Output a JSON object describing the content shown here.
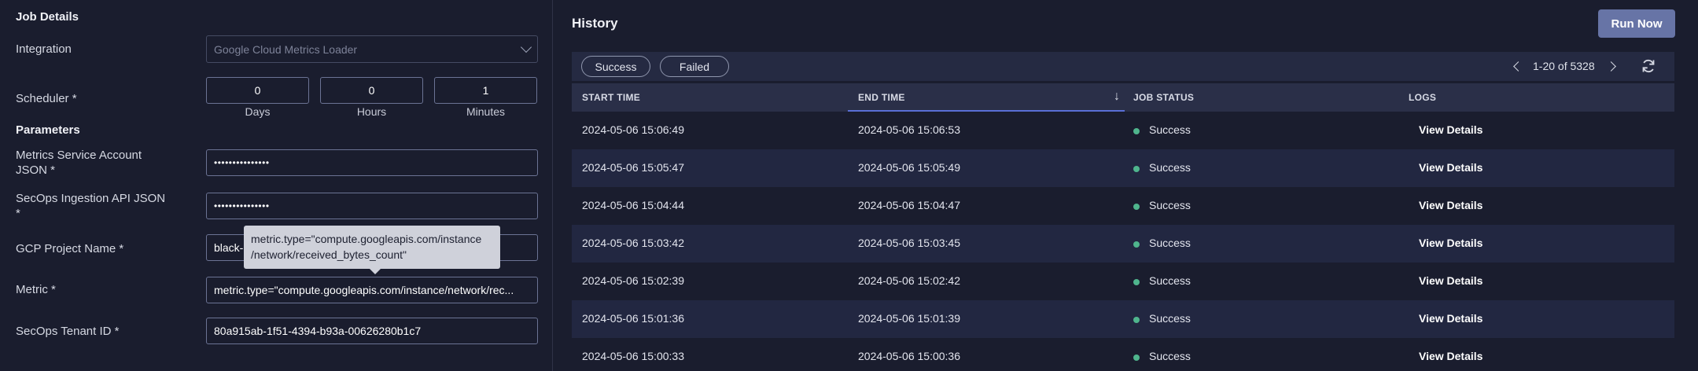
{
  "job_details": {
    "title": "Job Details",
    "integration_label": "Integration",
    "integration_value": "Google Cloud Metrics Loader",
    "scheduler_label": "Scheduler *",
    "scheduler": {
      "days_value": "0",
      "days_label": "Days",
      "hours_value": "0",
      "hours_label": "Hours",
      "minutes_value": "1",
      "minutes_label": "Minutes"
    }
  },
  "parameters": {
    "title": "Parameters",
    "metrics_sa_label_1": "Metrics Service Account",
    "metrics_sa_label_2": "JSON *",
    "metrics_sa_value": "•••••••••••••••",
    "ingestion_label_1": "SecOps Ingestion API JSON",
    "ingestion_label_2": "*",
    "ingestion_value": "•••••••••••••••",
    "gcp_project_label": "GCP Project Name *",
    "gcp_project_value": "black-",
    "metric_label": "Metric *",
    "metric_value": "metric.type=\"compute.googleapis.com/instance/network/rec...",
    "tenant_label": "SecOps Tenant ID *",
    "tenant_value": "80a915ab-1f51-4394-b93a-00626280b1c7"
  },
  "tooltip": {
    "line1": "metric.type=\"compute.googleapis.com/instance",
    "line2": "/network/received_bytes_count\""
  },
  "history": {
    "title": "History",
    "run_now": "Run Now",
    "filters": [
      "Success",
      "Failed"
    ],
    "pager_text": "1-20 of 5328",
    "columns": [
      "START TIME",
      "END TIME",
      "JOB STATUS",
      "LOGS"
    ],
    "rows": [
      {
        "start": "2024-05-06 15:06:49",
        "end": "2024-05-06 15:06:53",
        "status": "Success",
        "logs": "View Details"
      },
      {
        "start": "2024-05-06 15:05:47",
        "end": "2024-05-06 15:05:49",
        "status": "Success",
        "logs": "View Details"
      },
      {
        "start": "2024-05-06 15:04:44",
        "end": "2024-05-06 15:04:47",
        "status": "Success",
        "logs": "View Details"
      },
      {
        "start": "2024-05-06 15:03:42",
        "end": "2024-05-06 15:03:45",
        "status": "Success",
        "logs": "View Details"
      },
      {
        "start": "2024-05-06 15:02:39",
        "end": "2024-05-06 15:02:42",
        "status": "Success",
        "logs": "View Details"
      },
      {
        "start": "2024-05-06 15:01:36",
        "end": "2024-05-06 15:01:39",
        "status": "Success",
        "logs": "View Details"
      },
      {
        "start": "2024-05-06 15:00:33",
        "end": "2024-05-06 15:00:36",
        "status": "Success",
        "logs": "View Details"
      }
    ]
  },
  "colors": {
    "background": "#1a1d2e",
    "accent_button": "#6774a6",
    "success_dot": "#4fb58d",
    "sort_underline": "#5a6fd6"
  }
}
